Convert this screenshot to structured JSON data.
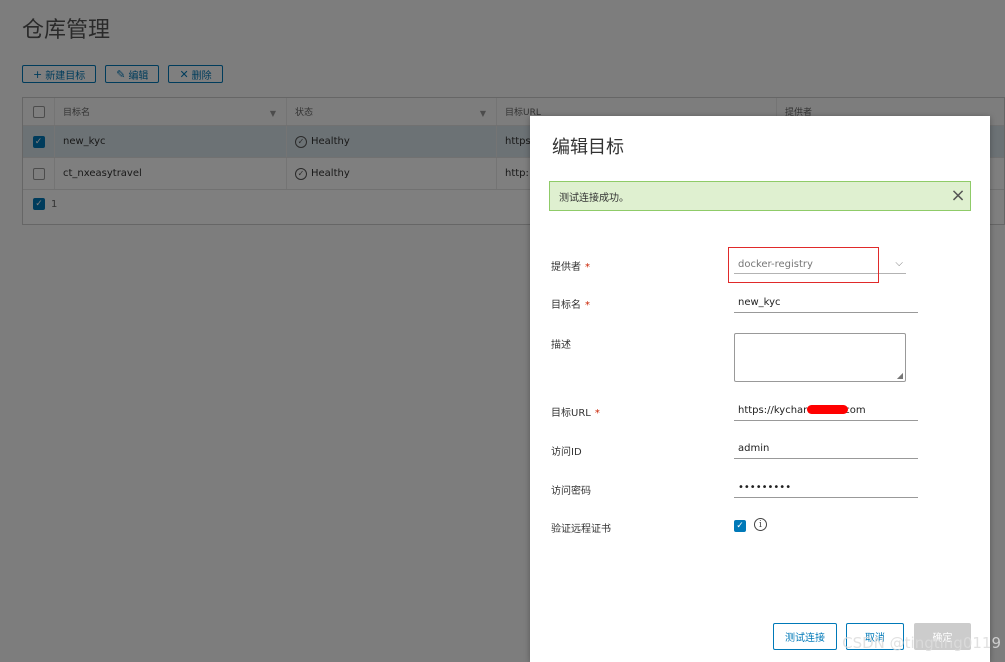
{
  "page": {
    "title": "仓库管理"
  },
  "toolbar": {
    "new_label": "新建目标",
    "edit_label": "编辑",
    "delete_label": "删除"
  },
  "grid": {
    "columns": [
      "目标名",
      "状态",
      "目标URL",
      "提供者"
    ],
    "rows": [
      {
        "name": "new_kyc",
        "status": "Healthy",
        "url": "https",
        "selected": true
      },
      {
        "name": "ct_nxeasytravel",
        "status": "Healthy",
        "url": "http:",
        "selected": false
      }
    ],
    "footer_count": "1"
  },
  "modal": {
    "title": "编辑目标",
    "alert_text": "测试连接成功。",
    "labels": {
      "provider": "提供者",
      "name": "目标名",
      "description": "描述",
      "url": "目标URL",
      "access_id": "访问ID",
      "access_secret": "访问密码",
      "verify_cert": "验证远程证书"
    },
    "required_mark": "*",
    "provider_value": "docker-registry",
    "name_value": "new_kyc",
    "url_value_prefix": "https://kychar",
    "url_value_suffix": "com",
    "access_id_value": "admin",
    "access_secret_value": "•••••••••",
    "verify_cert_checked": true,
    "buttons": {
      "test": "测试连接",
      "cancel": "取消",
      "confirm": "确定"
    }
  },
  "watermark": "CSDN @tingting0119",
  "colors": {
    "accent": "#0079b8",
    "alert_bg": "#dff0d0",
    "alert_border": "#8fcb68",
    "required": "#c92100",
    "highlight": "#e02a2a"
  }
}
